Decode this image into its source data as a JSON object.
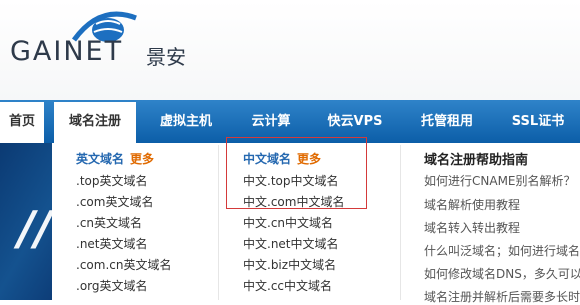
{
  "brand": {
    "logo_text": "GAINET",
    "logo_cn": "景安"
  },
  "nav": {
    "home": "首页",
    "items": [
      "域名注册",
      "虚拟主机",
      "云计算",
      "快云VPS",
      "托管租用",
      "SSL证书"
    ]
  },
  "dropdown": {
    "col1": {
      "title": "英文域名",
      "more": "更多",
      "items": [
        ".top英文域名",
        ".com英文域名",
        ".cn英文域名",
        ".net英文域名",
        ".com.cn英文域名",
        ".org英文域名"
      ]
    },
    "col2": {
      "title": "中文域名",
      "more": "更多",
      "items": [
        "中文.top中文域名",
        "中文.com中文域名",
        "中文.cn中文域名",
        "中文.net中文域名",
        "中文.biz中文域名",
        "中文.cc中文域名"
      ]
    },
    "help": {
      "title": "域名注册帮助指南",
      "items": [
        "如何进行CNAME别名解析？",
        "域名解析使用教程",
        "域名转入转出教程",
        "什么叫泛域名；如何进行域名",
        "如何修改域名DNS，多久可以",
        "域名注册并解析后需要多长时"
      ]
    }
  },
  "colors": {
    "nav_blue": "#1a6fb8",
    "highlight_border": "#d43a3a",
    "link_blue": "#2568b0",
    "more_orange": "#e06a00"
  }
}
